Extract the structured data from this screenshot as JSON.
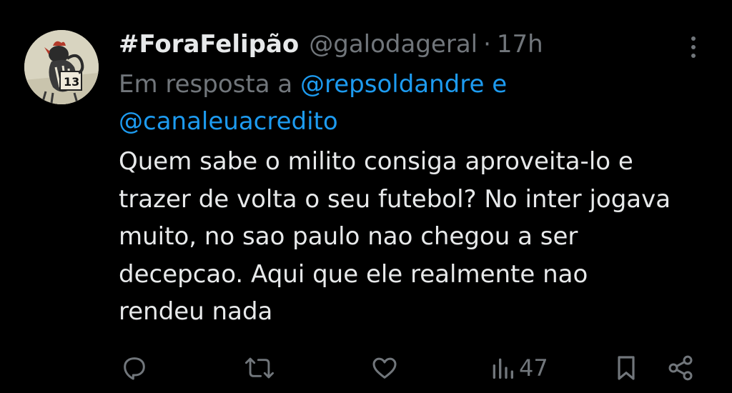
{
  "tweet": {
    "display_name": "#ForaFelipão",
    "handle": "@galodageral",
    "separator": "·",
    "time": "17h",
    "reply_prefix": "Em resposta a",
    "reply_mention_1": "@repsoldandre",
    "reply_conjunction": "e",
    "reply_mention_2": "@canaleuacredito",
    "body_lines": [
      "Quem sabe o milito consiga aproveita-lo e",
      "trazer de volta o seu futebol? No inter jogava",
      "muito, no sao paulo nao chegou a ser",
      "decepcao. Aqui que ele realmente nao",
      "rendeu nada"
    ],
    "views": "47"
  },
  "icons": {
    "more": "more-vertical-icon",
    "reply": "reply-icon",
    "retweet": "retweet-icon",
    "like": "heart-icon",
    "views": "views-chart-icon",
    "bookmark": "bookmark-icon",
    "share": "share-icon"
  },
  "colors": {
    "background": "#000000",
    "primary_text": "#e7e9ea",
    "secondary_text": "#71767b",
    "link": "#1d9bf0"
  }
}
